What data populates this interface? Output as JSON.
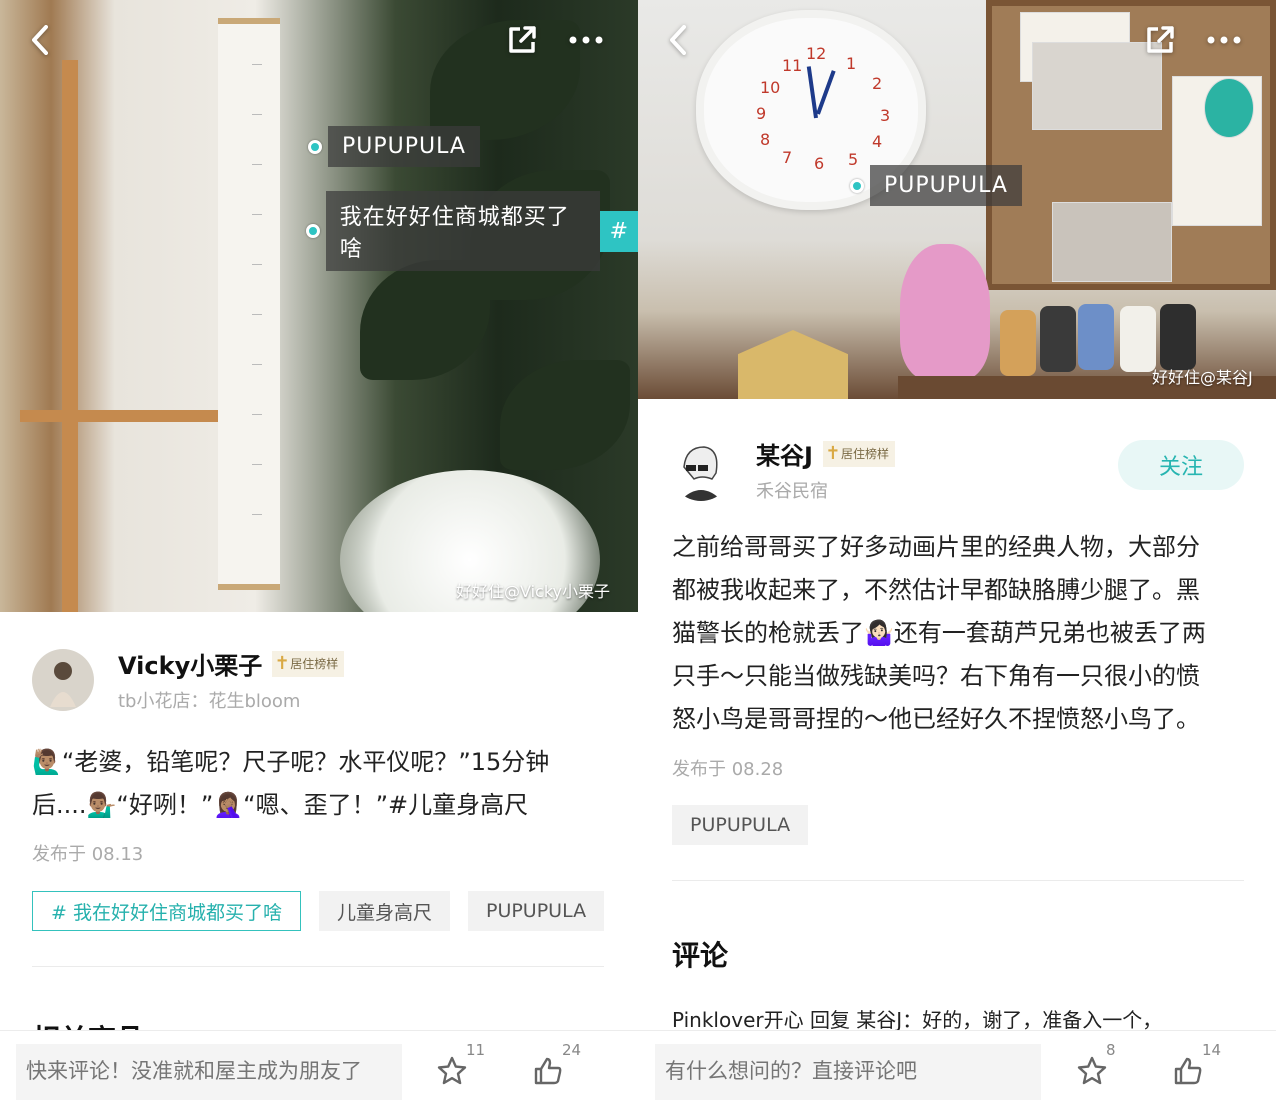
{
  "left": {
    "photo": {
      "tag1": "PUPUPULA",
      "tag2": "我在好好住商城都买了啥",
      "tag2_hash": "#",
      "watermark": "好好住@Vicky小栗子"
    },
    "author": {
      "name": "Vicky小栗子",
      "badge": "居住榜样",
      "subtitle": "tb小花店：花生bloom"
    },
    "post": {
      "line1": "🙋🏽‍♂️“老婆，铅笔呢？尺子呢？水平仪呢？”15分钟",
      "line2": "后....💁🏽‍♂️“好咧！”🤦🏽‍♀️“嗯、歪了！”#儿童身高尺",
      "date": "发布于 08.13"
    },
    "tags": [
      {
        "label": "# 我在好好住商城都买了啥"
      },
      {
        "label": "儿童身高尺"
      },
      {
        "label": "PUPUPULA"
      }
    ],
    "section_title": "相关商品",
    "bottom": {
      "placeholder": "快来评论！没准就和屋主成为朋友了",
      "star_count": "11",
      "like_count": "24"
    }
  },
  "right": {
    "photo": {
      "tag1": "PUPUPULA",
      "watermark": "好好住@某谷J"
    },
    "author": {
      "name": "某谷J",
      "badge": "居住榜样",
      "subtitle": "禾谷民宿",
      "follow": "关注"
    },
    "post": {
      "line1": "之前给哥哥买了好多动画片里的经典人物，大部分",
      "line2": "都被我收起来了，不然估计早都缺胳膊少腿了。黑",
      "line3": "猫警长的枪就丢了🤷🏻‍♀️还有一套葫芦兄弟也被丢了两",
      "line4": "只手～只能当做残缺美吗？右下角有一只很小的愤",
      "line5": "怒小鸟是哥哥捏的～他已经好久不捏愤怒小鸟了。",
      "date": "发布于 08.28"
    },
    "tags": [
      {
        "label": "PUPUPULA"
      }
    ],
    "comments_title": "评论",
    "comment_preview": "Pinklover开心 回复 某谷J：好的，谢了，准备入一个，",
    "bottom": {
      "placeholder": "有什么想问的？直接评论吧",
      "star_count": "8",
      "like_count": "14"
    }
  },
  "icons": {
    "back": "chevron-left-icon",
    "share": "share-external-icon",
    "more": "more-dots-icon",
    "star": "star-icon",
    "like": "thumbs-up-icon",
    "badge": "trophy-icon"
  },
  "colors": {
    "accent": "#2ec4c3",
    "follow_bg": "#e8f7f6",
    "badge_gold": "#d9a944"
  }
}
